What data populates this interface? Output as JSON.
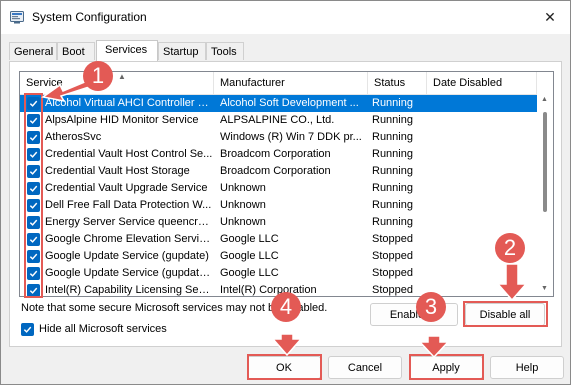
{
  "window": {
    "title": "System Configuration",
    "close_glyph": "✕"
  },
  "tabs": [
    {
      "label": "General"
    },
    {
      "label": "Boot"
    },
    {
      "label": "Services",
      "active": true
    },
    {
      "label": "Startup"
    },
    {
      "label": "Tools"
    }
  ],
  "table": {
    "columns": [
      "Service",
      "Manufacturer",
      "Status",
      "Date Disabled"
    ],
    "rows": [
      {
        "service": "Alcohol Virtual AHCI Controller M...",
        "manufacturer": "Alcohol Soft Development ...",
        "status": "Running",
        "checked": true,
        "selected": true
      },
      {
        "service": "AlpsAlpine HID Monitor Service",
        "manufacturer": "ALPSALPINE  CO., Ltd.",
        "status": "Running",
        "checked": true
      },
      {
        "service": "AtherosSvc",
        "manufacturer": "Windows (R) Win 7 DDK pr...",
        "status": "Running",
        "checked": true
      },
      {
        "service": "Credential Vault Host Control Se...",
        "manufacturer": "Broadcom Corporation",
        "status": "Running",
        "checked": true
      },
      {
        "service": "Credential Vault Host Storage",
        "manufacturer": "Broadcom Corporation",
        "status": "Running",
        "checked": true
      },
      {
        "service": "Credential Vault Upgrade Service",
        "manufacturer": "Unknown",
        "status": "Running",
        "checked": true
      },
      {
        "service": "Dell Free Fall Data Protection W...",
        "manufacturer": "Unknown",
        "status": "Running",
        "checked": true
      },
      {
        "service": "Energy Server Service queencreek",
        "manufacturer": "Unknown",
        "status": "Running",
        "checked": true
      },
      {
        "service": "Google Chrome Elevation Servic...",
        "manufacturer": "Google LLC",
        "status": "Stopped",
        "checked": true
      },
      {
        "service": "Google Update Service (gupdate)",
        "manufacturer": "Google LLC",
        "status": "Stopped",
        "checked": true
      },
      {
        "service": "Google Update Service (gupdatem)",
        "manufacturer": "Google LLC",
        "status": "Stopped",
        "checked": true
      },
      {
        "service": "Intel(R) Capability Licensing Serv...",
        "manufacturer": "Intel(R) Corporation",
        "status": "Stopped",
        "checked": true
      }
    ]
  },
  "note": "Note that some secure Microsoft services may not be disabled.",
  "buttons": {
    "enable_all": "Enable all",
    "disable_all": "Disable all",
    "ok": "OK",
    "cancel": "Cancel",
    "apply": "Apply",
    "help": "Help"
  },
  "hide_microsoft": {
    "label": "Hide all Microsoft services",
    "checked": true
  },
  "annotations": {
    "color": "#e35a55",
    "badges": [
      "1",
      "2",
      "3",
      "4"
    ]
  }
}
